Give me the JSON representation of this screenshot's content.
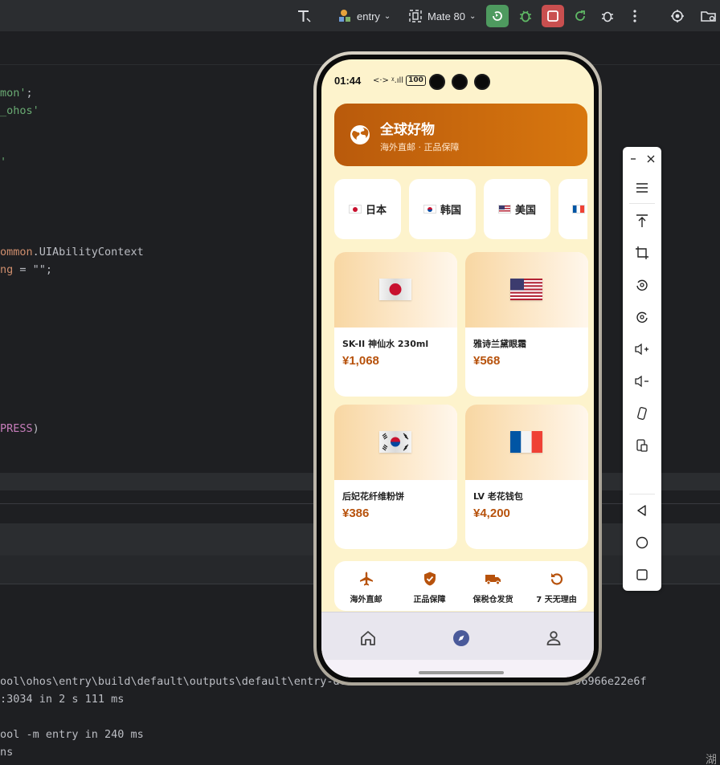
{
  "toolbar": {
    "module": "entry",
    "device": "Mate 80"
  },
  "code_lines": [
    {
      "a": "mon'",
      "b": ";"
    },
    {
      "a": "_ohos'",
      "b": ""
    },
    {
      "a": "'",
      "b": ""
    },
    {
      "a": "ommon",
      "b": ".UIAbilityContext"
    },
    {
      "a": "ng",
      "b": " = \"\";"
    },
    {
      "a": "PRESS",
      "b": ")"
    }
  ],
  "console": [
    "ool\\ohos\\entry\\build\\default\\outputs\\default\\entry-de           ...          ccbd7fc4ebf96966e22e6f",
    ":3034 in 2 s 111 ms",
    "ool -m entry in 240 ms",
    "ns"
  ],
  "phone": {
    "status": {
      "time": "01:44",
      "signal": "<·>",
      "wifi": "ᵡ.ıll",
      "battery": "100"
    },
    "banner": {
      "title": "全球好物",
      "subtitle": "海外直邮 · 正品保障"
    },
    "countries": [
      {
        "label": "日本",
        "flag": "jp"
      },
      {
        "label": "韩国",
        "flag": "kr"
      },
      {
        "label": "美国",
        "flag": "us"
      },
      {
        "label": "",
        "flag": "fr"
      }
    ],
    "products": [
      {
        "name": "SK-II 神仙水 230ml",
        "price": "¥1,068",
        "flag": "jp"
      },
      {
        "name": "雅诗兰黛眼霜",
        "price": "¥568",
        "flag": "us"
      },
      {
        "name": "后妃花纤维粉饼",
        "price": "¥386",
        "flag": "kr"
      },
      {
        "name": "LV 老花钱包",
        "price": "¥4,200",
        "flag": "fr"
      }
    ],
    "features": [
      {
        "label": "海外直邮",
        "icon": "airplane-icon"
      },
      {
        "label": "正品保障",
        "icon": "shield-check-icon"
      },
      {
        "label": "保税仓发货",
        "icon": "truck-icon"
      },
      {
        "label": "7 天无理由",
        "icon": "refresh-icon"
      }
    ],
    "tabs": [
      "home-icon",
      "compass-icon",
      "person-icon"
    ],
    "colors": {
      "accent": "#b7520c",
      "banner_start": "#b95a0c",
      "banner_end": "#d8770e",
      "background": "#fdf3cc"
    }
  },
  "emulator_tools": [
    "minimize-icon",
    "close-icon",
    "menu-icon",
    "pin-top-icon",
    "crop-icon",
    "rotate-left-icon",
    "rotate-right-icon",
    "volume-up-icon",
    "volume-down-icon",
    "shake-icon",
    "screenshot-icon",
    "back-icon",
    "home-circle-icon",
    "recents-icon"
  ],
  "corner_text": "湖"
}
